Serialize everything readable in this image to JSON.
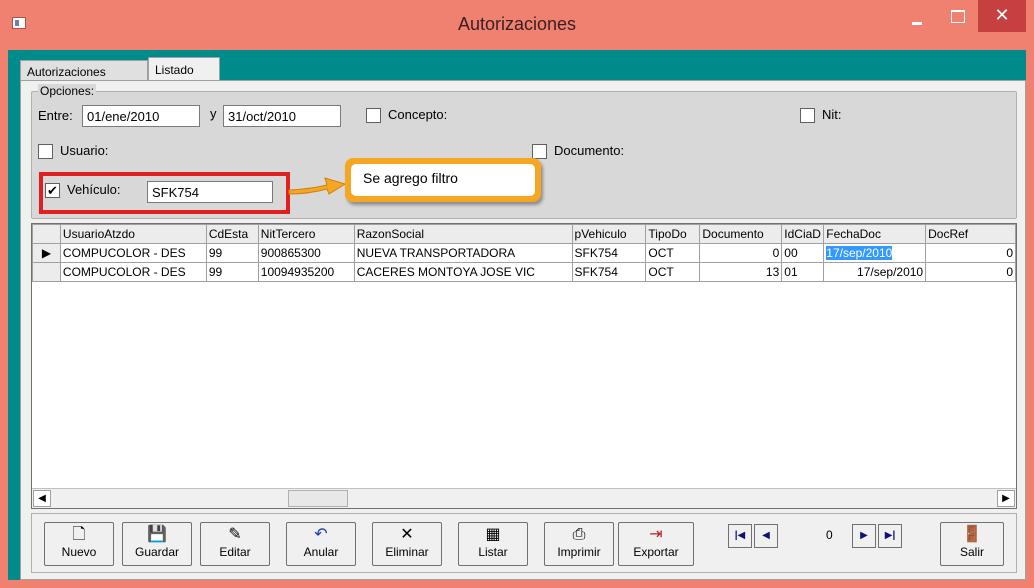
{
  "window": {
    "title": "Autorizaciones",
    "close_glyph": "✕"
  },
  "tabs": [
    "Autorizaciones",
    "Listado"
  ],
  "options": {
    "legend": "Opciones:",
    "entre_label": "Entre:",
    "from_date": "01/ene/2010",
    "y_label": "y",
    "to_date": "31/oct/2010",
    "concepto_label": "Concepto:",
    "nit_label": "Nit:",
    "usuario_label": "Usuario:",
    "documento_label": "Documento:",
    "vehiculo_label": "Vehículo:",
    "vehiculo_value": "SFK754",
    "vehiculo_checked": "✔"
  },
  "callout": {
    "text": "Se agrego filtro"
  },
  "grid": {
    "columns": [
      "UsuarioAtzdo",
      "CdEsta",
      "NitTercero",
      "RazonSocial",
      "pVehiculo",
      "TipoDo",
      "Documento",
      "IdCiaD",
      "FechaDoc",
      "DocRef"
    ],
    "rows": [
      [
        "COMPUCOLOR - DES",
        "99",
        "900865300",
        "NUEVA TRANSPORTADORA",
        "SFK754",
        "OCT",
        "0",
        "00",
        "17/sep/2010",
        "0"
      ],
      [
        "COMPUCOLOR - DES",
        "99",
        "10094935200",
        "CACERES MONTOYA JOSE VIC",
        "SFK754",
        "OCT",
        "13",
        "01",
        "17/sep/2010",
        "0"
      ]
    ],
    "row_pointer": "▶"
  },
  "toolbar": {
    "nuevo": "Nuevo",
    "guardar": "Guardar",
    "editar": "Editar",
    "anular": "Anular",
    "eliminar": "Eliminar",
    "listar": "Listar",
    "imprimir": "Imprimir",
    "exportar": "Exportar",
    "record_index": "0",
    "salir": "Salir"
  },
  "colors": {
    "window_frame": "#f08070",
    "client_bg": "#008b8b",
    "highlight": "#3399ff",
    "callout": "#f5a623",
    "filter_box": "#e02020"
  }
}
